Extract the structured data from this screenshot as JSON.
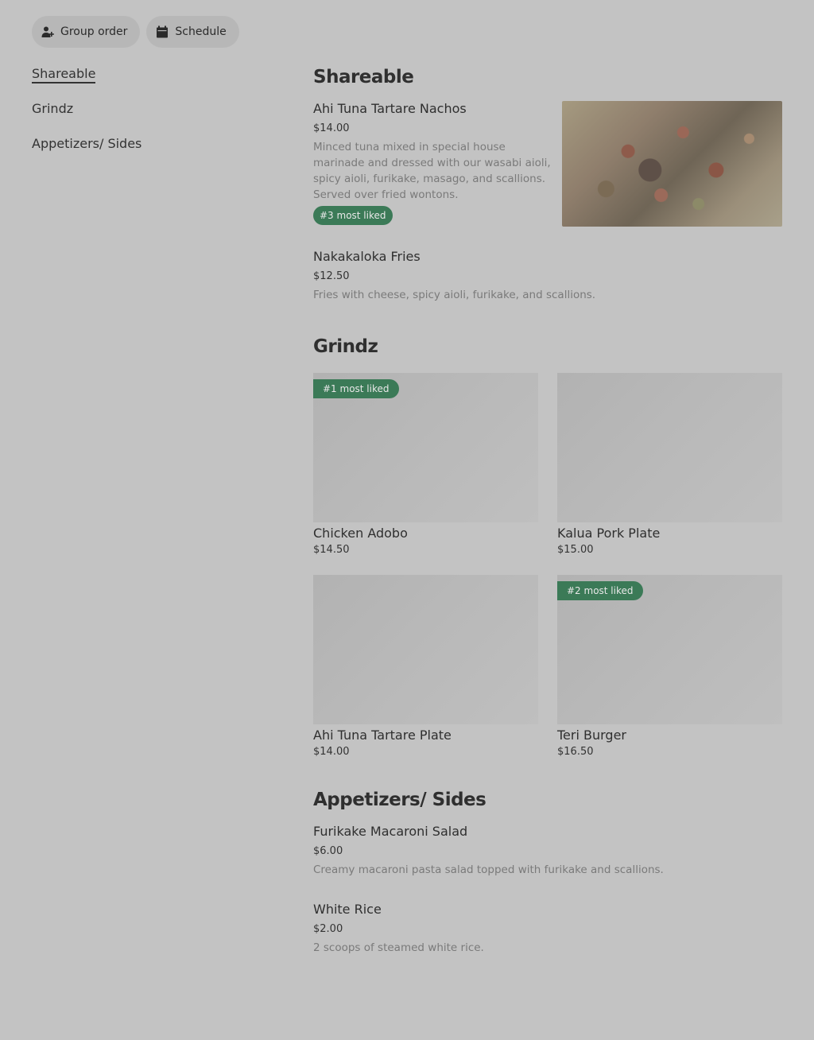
{
  "actions": {
    "group_order": "Group order",
    "schedule": "Schedule"
  },
  "nav": {
    "items": [
      {
        "label": "Shareable"
      },
      {
        "label": "Grindz"
      },
      {
        "label": "Appetizers/ Sides"
      }
    ]
  },
  "sections": {
    "shareable": {
      "title": "Shareable",
      "items": [
        {
          "name": "Ahi Tuna Tartare Nachos",
          "price": "$14.00",
          "description": "Minced tuna mixed in special house marinade and dressed with our wasabi aioli, spicy aioli, furikake, masago, and scallions. Served over fried wontons.",
          "badge": "#3 most liked"
        },
        {
          "name": "Nakakaloka Fries",
          "price": "$12.50",
          "description": "Fries with cheese, spicy aioli, furikake, and scallions."
        }
      ]
    },
    "grindz": {
      "title": "Grindz",
      "items": [
        {
          "name": "Chicken Adobo",
          "price": "$14.50",
          "badge": "#1 most liked"
        },
        {
          "name": "Kalua Pork Plate",
          "price": "$15.00"
        },
        {
          "name": "Ahi Tuna Tartare Plate",
          "price": "$14.00"
        },
        {
          "name": "Teri Burger",
          "price": "$16.50",
          "badge": "#2 most liked"
        }
      ]
    },
    "appetizers": {
      "title": "Appetizers/ Sides",
      "items": [
        {
          "name": "Furikake Macaroni Salad",
          "price": "$6.00",
          "description": "Creamy macaroni pasta salad topped with furikake and scallions."
        },
        {
          "name": "White Rice",
          "price": "$2.00",
          "description": "2 scoops of steamed white rice."
        }
      ]
    }
  },
  "colors": {
    "background": "#c3c3c3",
    "badge": "#3b7a57",
    "pill": "#b7b7b7"
  }
}
